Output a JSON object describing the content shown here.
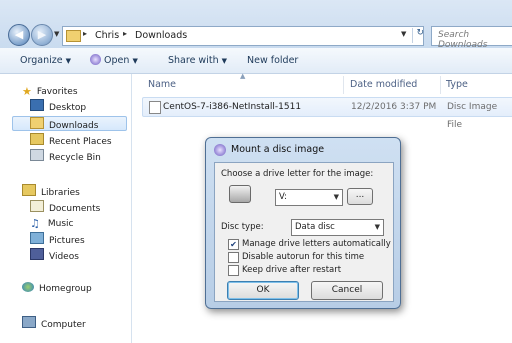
{
  "address": {
    "crumbs": [
      "Chris",
      "Downloads"
    ],
    "search_placeholder": "Search Downloads"
  },
  "toolbar": {
    "organize": "Organize",
    "open": "Open",
    "share_with": "Share with",
    "new_folder": "New folder"
  },
  "nav": {
    "favorites_header": "Favorites",
    "favorites": [
      "Desktop",
      "Downloads",
      "Recent Places",
      "Recycle Bin"
    ],
    "libraries_header": "Libraries",
    "libraries": [
      "Documents",
      "Music",
      "Pictures",
      "Videos"
    ],
    "homegroup": "Homegroup",
    "computer": "Computer"
  },
  "files": {
    "columns": [
      "Name",
      "Date modified",
      "Type"
    ],
    "rows": [
      {
        "name": "CentOS-7-i386-NetInstall-1511",
        "date": "12/2/2016 3:37 PM",
        "type": "Disc Image File"
      }
    ]
  },
  "dialog": {
    "title": "Mount a disc image",
    "drive_prompt": "Choose a drive letter for the image:",
    "drive_value": "V:",
    "browse_label": "...",
    "disc_type_label": "Disc type:",
    "disc_type_value": "Data disc",
    "options": [
      {
        "label": "Manage drive letters automatically",
        "checked": true
      },
      {
        "label": "Disable autorun for this time",
        "checked": false
      },
      {
        "label": "Keep drive after restart",
        "checked": false
      }
    ],
    "ok": "OK",
    "cancel": "Cancel"
  }
}
